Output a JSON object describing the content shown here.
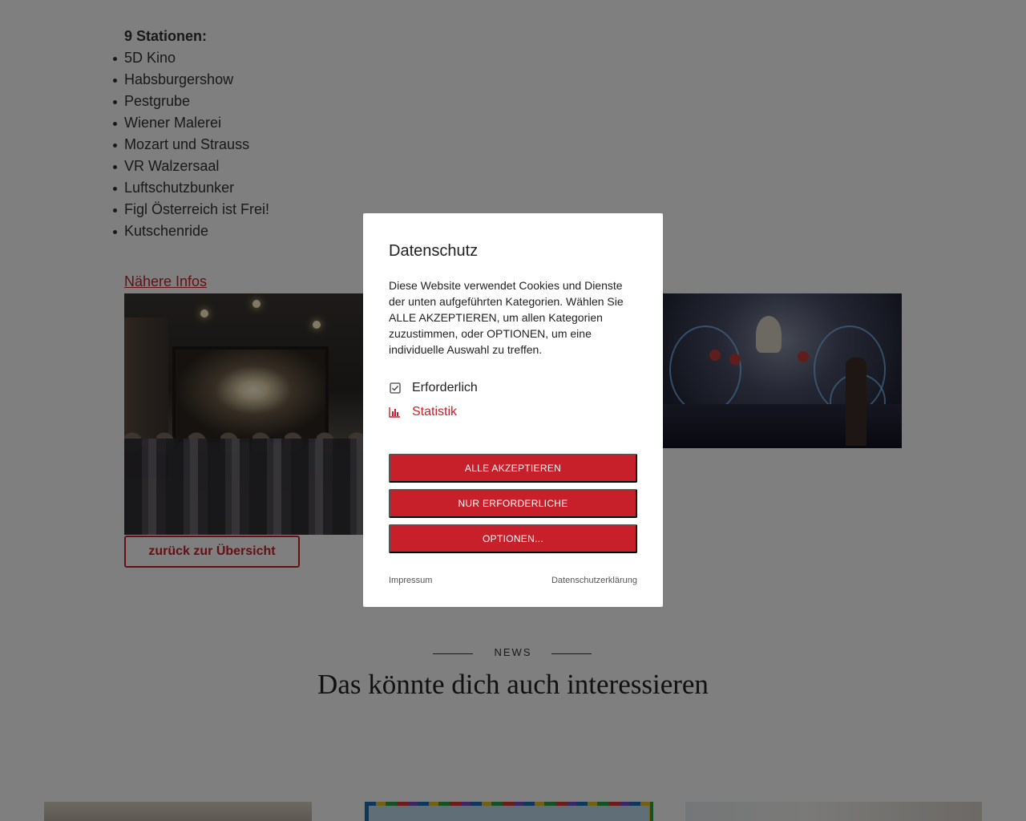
{
  "content": {
    "stations_heading": "9 Stationen:",
    "stations": [
      "5D Kino",
      "Habsburgershow",
      "Pestgrube",
      "Wiener Malerei",
      "Mozart und Strauss",
      "VR Walzersaal",
      "Luftschutzbunker",
      "Figl Österreich ist Frei!",
      "Kutschenride"
    ],
    "more_link": "Nähere Infos",
    "back_button": "zurück zur Übersicht"
  },
  "news": {
    "kicker": "NEWS",
    "title": "Das könnte dich auch interessieren"
  },
  "modal": {
    "title": "Datenschutz",
    "text": "Diese Website verwendet Cookies und Dienste der unten aufgeführten Kategorien. Wählen Sie ALLE AKZEPTIEREN, um allen Kategorien zuzustimmen, oder OPTIONEN, um eine individuelle Auswahl zu treffen.",
    "categories": [
      {
        "label": "Erforderlich",
        "icon": "checkbox-checked-icon"
      },
      {
        "label": "Statistik",
        "icon": "bar-chart-icon"
      }
    ],
    "buttons": {
      "accept_all": "ALLE AKZEPTIEREN",
      "required_only": "NUR ERFORDERLICHE",
      "options": "OPTIONEN..."
    },
    "footer": {
      "imprint": "Impressum",
      "privacy": "Datenschutzerklärung"
    }
  },
  "colors": {
    "accent": "#c8202a",
    "overlay": "rgba(0,0,0,0.5)"
  }
}
